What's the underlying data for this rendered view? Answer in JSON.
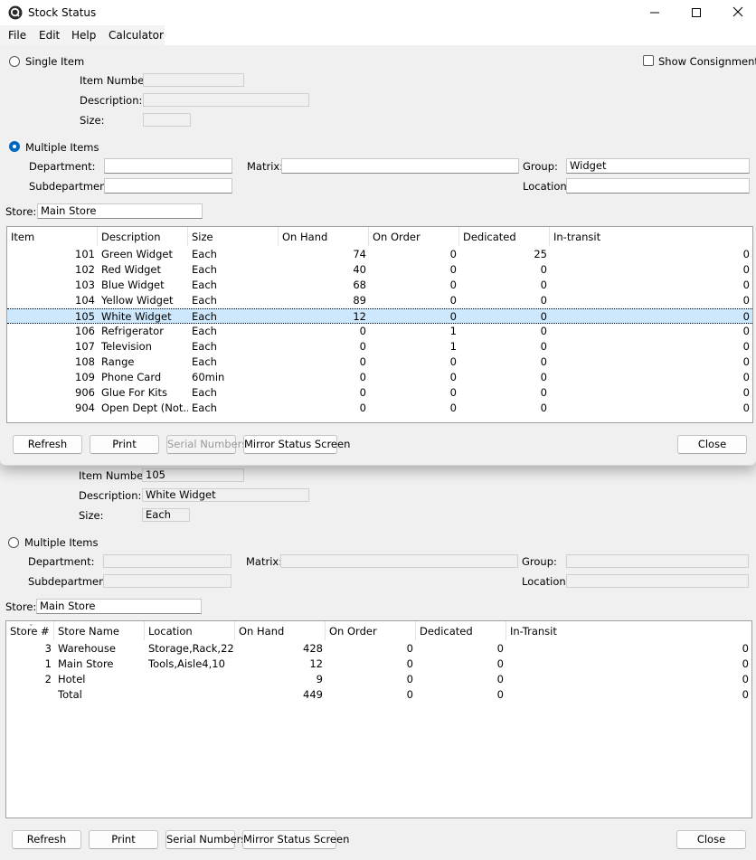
{
  "title": "Stock Status",
  "menu": [
    "File",
    "Edit",
    "Help",
    "Calculator"
  ],
  "front": {
    "single_item_label": "Single Item",
    "show_consignment_label": "Show Consignment?",
    "item_number_label": "Item Number:",
    "description_label": "Description:",
    "size_label": "Size:",
    "item_number_value": "",
    "description_value": "",
    "size_value": "",
    "multiple_items_label": "Multiple Items",
    "department_label": "Department:",
    "matrix_label": "Matrix:",
    "group_label": "Group:",
    "group_value": "Widget",
    "subdepartment_label": "Subdepartment:",
    "location_label": "Location:",
    "store_label": "Store:",
    "store_value": "Main Store",
    "columns": [
      "Item",
      "Description",
      "Size",
      "On Hand",
      "On Order",
      "Dedicated",
      "In-transit"
    ],
    "rows": [
      {
        "item": "101",
        "desc": "Green Widget",
        "size": "Each",
        "onhand": "74",
        "onorder": "0",
        "dedicated": "25",
        "intransit": "0"
      },
      {
        "item": "102",
        "desc": "Red Widget",
        "size": "Each",
        "onhand": "40",
        "onorder": "0",
        "dedicated": "0",
        "intransit": "0"
      },
      {
        "item": "103",
        "desc": "Blue Widget",
        "size": "Each",
        "onhand": "68",
        "onorder": "0",
        "dedicated": "0",
        "intransit": "0"
      },
      {
        "item": "104",
        "desc": "Yellow Widget",
        "size": "Each",
        "onhand": "89",
        "onorder": "0",
        "dedicated": "0",
        "intransit": "0"
      },
      {
        "item": "105",
        "desc": "White Widget",
        "size": "Each",
        "onhand": "12",
        "onorder": "0",
        "dedicated": "0",
        "intransit": "0"
      },
      {
        "item": "106",
        "desc": "Refrigerator",
        "size": "Each",
        "onhand": "0",
        "onorder": "1",
        "dedicated": "0",
        "intransit": "0"
      },
      {
        "item": "107",
        "desc": "Television",
        "size": "Each",
        "onhand": "0",
        "onorder": "1",
        "dedicated": "0",
        "intransit": "0"
      },
      {
        "item": "108",
        "desc": "Range",
        "size": "Each",
        "onhand": "0",
        "onorder": "0",
        "dedicated": "0",
        "intransit": "0"
      },
      {
        "item": "109",
        "desc": "Phone Card",
        "size": "60min",
        "onhand": "0",
        "onorder": "0",
        "dedicated": "0",
        "intransit": "0"
      },
      {
        "item": "906",
        "desc": "Glue For Kits",
        "size": "Each",
        "onhand": "0",
        "onorder": "0",
        "dedicated": "0",
        "intransit": "0"
      },
      {
        "item": "904",
        "desc": "Open Dept (Not...",
        "size": "Each",
        "onhand": "0",
        "onorder": "0",
        "dedicated": "0",
        "intransit": "0"
      }
    ],
    "buttons": {
      "refresh": "Refresh",
      "print": "Print",
      "serial": "Serial Numbers",
      "mirror": "Mirror Status Screen",
      "close": "Close"
    }
  },
  "back": {
    "item_number_label": "Item Number:",
    "item_number_value": "105",
    "description_label": "Description:",
    "description_value": "White Widget",
    "size_label": "Size:",
    "size_value": "Each",
    "multiple_items_label": "Multiple Items",
    "department_label": "Department:",
    "matrix_label": "Matrix:",
    "group_label": "Group:",
    "subdepartment_label": "Subdepartment:",
    "location_label": "Location:",
    "store_label": "Store:",
    "store_value": "Main Store",
    "columns": [
      "Store #",
      "Store Name",
      "Location",
      "On Hand",
      "On Order",
      "Dedicated",
      "In-Transit"
    ],
    "rows": [
      {
        "num": "3",
        "name": "Warehouse",
        "loc": "Storage,Rack,22",
        "onhand": "428",
        "onorder": "0",
        "dedicated": "0",
        "intransit": "0"
      },
      {
        "num": "1",
        "name": "Main Store",
        "loc": "Tools,Aisle4,10",
        "onhand": "12",
        "onorder": "0",
        "dedicated": "0",
        "intransit": "0"
      },
      {
        "num": "2",
        "name": "Hotel",
        "loc": "",
        "onhand": "9",
        "onorder": "0",
        "dedicated": "0",
        "intransit": "0"
      },
      {
        "num": "",
        "name": "Total",
        "loc": "",
        "onhand": "449",
        "onorder": "0",
        "dedicated": "0",
        "intransit": "0"
      }
    ],
    "buttons": {
      "refresh": "Refresh",
      "print": "Print",
      "serial": "Serial Numbers",
      "mirror": "Mirror Status Screen",
      "close": "Close"
    }
  },
  "icons": {
    "app": "app-logo-icon",
    "minimize": "minimize-icon",
    "maximize": "maximize-icon",
    "close": "close-icon"
  }
}
